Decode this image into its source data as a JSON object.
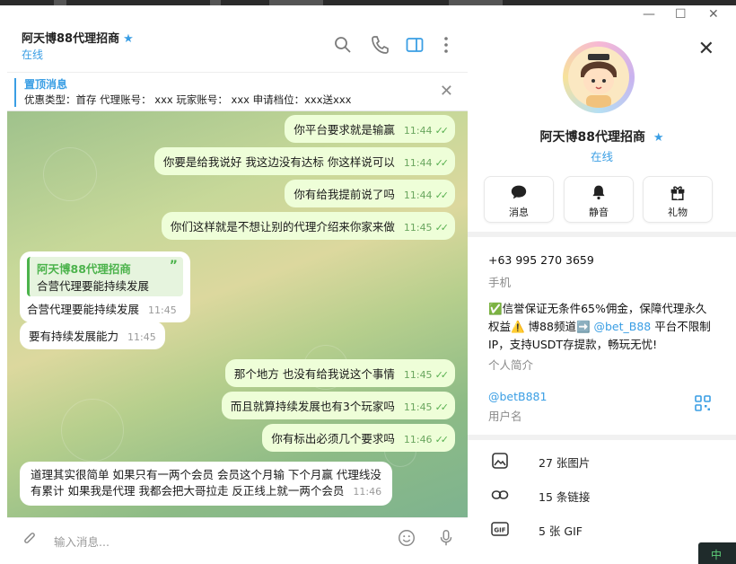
{
  "window": {
    "minimize": "—",
    "maximize": "☐",
    "close": "✕"
  },
  "chat": {
    "title": "阿天博88代理招商",
    "verified": "★",
    "status": "在线",
    "icons": [
      "search-icon",
      "phone-icon",
      "sidebar-toggle-icon",
      "more-icon"
    ]
  },
  "pinned": {
    "title": "置顶消息",
    "text": "优惠类型：首存 代理账号： xxx  玩家账号： xxx 申请档位：xxx送xxx",
    "close": "✕"
  },
  "messages": [
    {
      "dir": "out",
      "text": "你平台要求就是输赢",
      "time": "11:44"
    },
    {
      "dir": "out",
      "text": "你要是给我说好 我这边没有达标 你这样说可以",
      "time": "11:44"
    },
    {
      "dir": "out",
      "text": "你有给我提前说了吗",
      "time": "11:44"
    },
    {
      "dir": "out",
      "text": "你们这样就是不想让别的代理介绍来你家来做",
      "time": "11:45"
    },
    {
      "dir": "in",
      "quote_name": "阿天博88代理招商",
      "quote_text": "合营代理要能持续发展",
      "text": "合营代理要能持续发展",
      "time": "11:45"
    },
    {
      "dir": "in",
      "text": "要有持续发展能力",
      "time": "11:45"
    },
    {
      "dir": "out",
      "text": "那个地方 也没有给我说这个事情",
      "time": "11:45"
    },
    {
      "dir": "out",
      "text": "而且就算持续发展也有3个玩家吗",
      "time": "11:45"
    },
    {
      "dir": "out",
      "text": "你有标出必须几个要求吗",
      "time": "11:46"
    },
    {
      "dir": "in",
      "line1": "道理其实很简单 如果只有一两个会员 会员这个月输 下个月赢 代理线没",
      "line2": "有累计 如果我是代理 我都会把大哥拉走 反正线上就一两个会员",
      "time": "11:46"
    }
  ],
  "composer": {
    "placeholder": "输入消息..."
  },
  "profile": {
    "name": "阿天博88代理招商",
    "status": "在线",
    "actions": [
      {
        "label": "消息",
        "icon": "message-icon"
      },
      {
        "label": "静音",
        "icon": "bell-icon"
      },
      {
        "label": "礼物",
        "icon": "gift-icon"
      }
    ],
    "phone": "+63 995 270 3659",
    "phone_label": "手机",
    "bio_part1": "✅信誉保证无条件65%佣金，保障代理永久权益⚠️ 博88频道➡️ ",
    "bio_link": "@bet_B88",
    "bio_part2": " 平台不限制IP，支持USDT存提款，畅玩无忧!",
    "bio_label": "个人简介",
    "username": "@betB881",
    "username_label": "用户名",
    "media": [
      {
        "icon": "photo-icon",
        "label": "27 张图片"
      },
      {
        "icon": "link-icon",
        "label": "15 条链接"
      },
      {
        "icon": "gif-icon",
        "label": "5 张 GIF"
      }
    ]
  },
  "tray": {
    "text": "中"
  }
}
